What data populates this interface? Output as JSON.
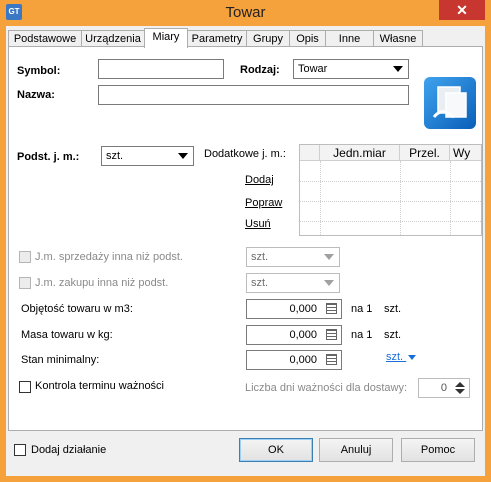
{
  "window": {
    "title": "Towar",
    "app_icon_text": "GT"
  },
  "tabs": [
    "Podstawowe",
    "Urządzenia",
    "Miary",
    "Parametry",
    "Grupy",
    "Opis",
    "Inne",
    "Własne"
  ],
  "form": {
    "symbol_label": "Symbol:",
    "symbol_value": "",
    "rodzaj_label": "Rodzaj:",
    "rodzaj_value": "Towar",
    "nazwa_label": "Nazwa:",
    "nazwa_value": "",
    "podst_jm_label": "Podst. j. m.:",
    "podst_jm_value": "szt.",
    "dodatkowe_jm_label": "Dodatkowe j. m.:",
    "dodaj_link": "Dodaj",
    "popraw_link": "Popraw",
    "usun_link": "Usuń",
    "grid_headers": [
      "Jedn.miar",
      "Przel.",
      "Wy"
    ],
    "jm_sprzedazy_label": "J.m. sprzedaży inna niż podst.",
    "jm_sprzedazy_value": "szt.",
    "jm_zakupu_label": "J.m. zakupu inna niż podst.",
    "jm_zakupu_value": "szt.",
    "objetosc_label": "Objętość towaru w m3:",
    "objetosc_value": "0,000",
    "objetosc_per": "na 1",
    "objetosc_unit": "szt.",
    "masa_label": "Masa towaru w kg:",
    "masa_value": "0,000",
    "masa_per": "na 1",
    "masa_unit": "szt.",
    "stan_label": "Stan minimalny:",
    "stan_value": "0,000",
    "stan_unit_link": "szt.",
    "kontrola_label": "Kontrola terminu ważności",
    "liczba_dni_label": "Liczba dni ważności dla dostawy:",
    "liczba_dni_value": "0"
  },
  "footer": {
    "dodaj_dzialanie_label": "Dodaj działanie",
    "ok_label": "OK",
    "anuluj_label": "Anuluj",
    "pomoc_label": "Pomoc"
  }
}
